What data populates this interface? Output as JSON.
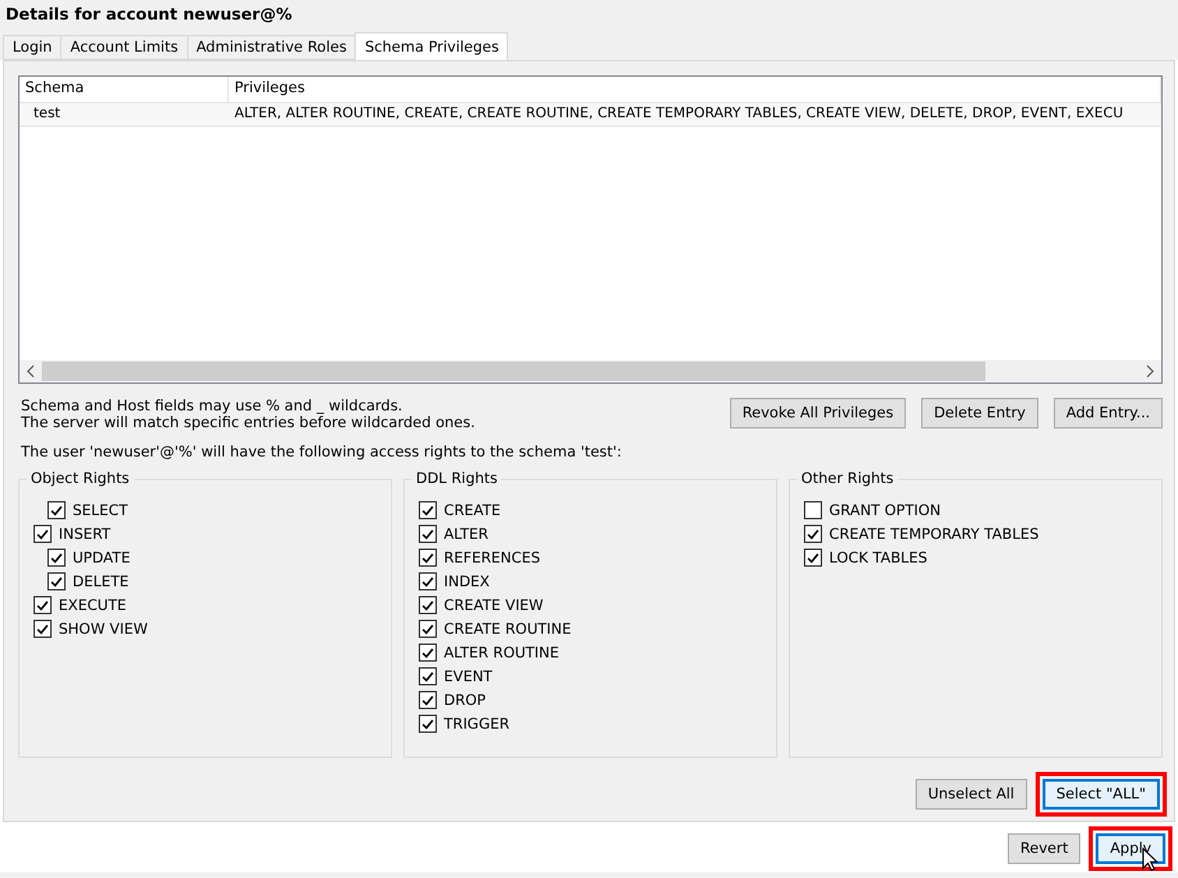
{
  "title": "Details for account newuser@%",
  "tabs": [
    {
      "label": "Login",
      "selected": false
    },
    {
      "label": "Account Limits",
      "selected": false
    },
    {
      "label": "Administrative Roles",
      "selected": false
    },
    {
      "label": "Schema Privileges",
      "selected": true
    }
  ],
  "table": {
    "columns": [
      "Schema",
      "Privileges"
    ],
    "rows": [
      {
        "cells": [
          "test",
          "ALTER, ALTER ROUTINE, CREATE, CREATE ROUTINE, CREATE TEMPORARY TABLES, CREATE VIEW, DELETE, DROP, EVENT, EXECU"
        ],
        "selected": false
      }
    ]
  },
  "hint_lines": [
    "Schema and Host fields may use % and _ wildcards.",
    "The server will match specific entries before wildcarded ones."
  ],
  "entry_buttons": [
    "Revoke All Privileges",
    "Delete Entry",
    "Add Entry..."
  ],
  "access_text": "The user 'newuser'@'%' will have the following access rights to the schema 'test':",
  "groups": [
    {
      "title": "Object Rights",
      "items": [
        {
          "label": "SELECT",
          "checked": true,
          "kind": "sub"
        },
        {
          "label": "INSERT",
          "checked": true,
          "kind": "main",
          "children": [
            {
              "label": "UPDATE",
              "checked": true,
              "kind": "sub"
            },
            {
              "label": "DELETE",
              "checked": true,
              "kind": "sub"
            }
          ]
        },
        {
          "label": "EXECUTE",
          "checked": true,
          "kind": "main"
        },
        {
          "label": "SHOW VIEW",
          "checked": true,
          "kind": "main"
        }
      ]
    },
    {
      "title": "DDL Rights",
      "items": [
        {
          "label": "CREATE",
          "checked": true,
          "kind": "main"
        },
        {
          "label": "ALTER",
          "checked": true,
          "kind": "main"
        },
        {
          "label": "REFERENCES",
          "checked": true,
          "kind": "main"
        },
        {
          "label": "INDEX",
          "checked": true,
          "kind": "main"
        },
        {
          "label": "CREATE VIEW",
          "checked": true,
          "kind": "main"
        },
        {
          "label": "CREATE ROUTINE",
          "checked": true,
          "kind": "main"
        },
        {
          "label": "ALTER ROUTINE",
          "checked": true,
          "kind": "main"
        },
        {
          "label": "EVENT",
          "checked": true,
          "kind": "main"
        },
        {
          "label": "DROP",
          "checked": true,
          "kind": "main"
        },
        {
          "label": "TRIGGER",
          "checked": true,
          "kind": "main"
        }
      ]
    },
    {
      "title": "Other Rights",
      "items": [
        {
          "label": "GRANT OPTION",
          "checked": false,
          "kind": "main"
        },
        {
          "label": "CREATE TEMPORARY TABLES",
          "checked": true,
          "kind": "main"
        },
        {
          "label": "LOCK TABLES",
          "checked": true,
          "kind": "main"
        }
      ]
    }
  ],
  "select_buttons": [
    {
      "label": "Unselect All",
      "highlighted": false,
      "focused": false
    },
    {
      "label": "Select \"ALL\"",
      "highlighted": true,
      "focused": true
    }
  ],
  "footer_buttons": [
    {
      "label": "Revert",
      "highlighted": false,
      "focused": false
    },
    {
      "label": "Apply",
      "highlighted": true,
      "focused": true
    }
  ]
}
